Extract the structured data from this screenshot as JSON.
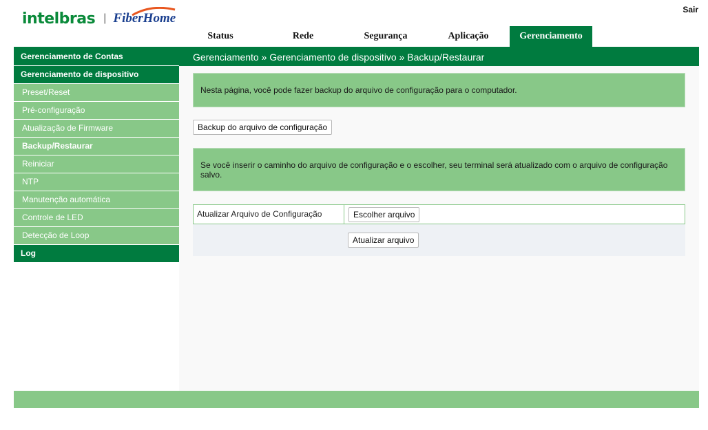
{
  "brand": {
    "name1": "intelbras",
    "separator": "|",
    "name2": "FiberHome"
  },
  "header": {
    "logout": "Sair"
  },
  "topnav": [
    "Status",
    "Rede",
    "Segurança",
    "Aplicação",
    "Gerenciamento"
  ],
  "active_tab": "Gerenciamento",
  "sidebar": {
    "section1": "Gerenciamento de Contas",
    "section2": "Gerenciamento de dispositivo",
    "items": [
      "Preset/Reset",
      "Pré-configuração",
      "Atualização de Firmware",
      "Backup/Restaurar",
      "Reiniciar",
      "NTP",
      "Manutenção automática",
      "Controle de LED",
      "Detecção de Loop"
    ],
    "current": "Backup/Restaurar",
    "section3": "Log"
  },
  "main": {
    "breadcrumb": "Gerenciamento » Gerenciamento de dispositivo » Backup/Restaurar",
    "info1": "Nesta página, você pode fazer backup do arquivo de configuração para o computador.",
    "backup_button": "Backup do arquivo de configuração",
    "info2": "Se você inserir o caminho do arquivo de configuração e o escolher, seu terminal será atualizado com o arquivo de configuração salvo.",
    "update_label": "Atualizar Arquivo de Configuração",
    "choose_file_button": "Escolher arquivo",
    "update_button": "Atualizar arquivo"
  },
  "colors": {
    "dark_green": "#007b3f",
    "light_green": "#88c888",
    "brand_green": "#0a8a3a",
    "brand_blue": "#1a3f8f"
  }
}
